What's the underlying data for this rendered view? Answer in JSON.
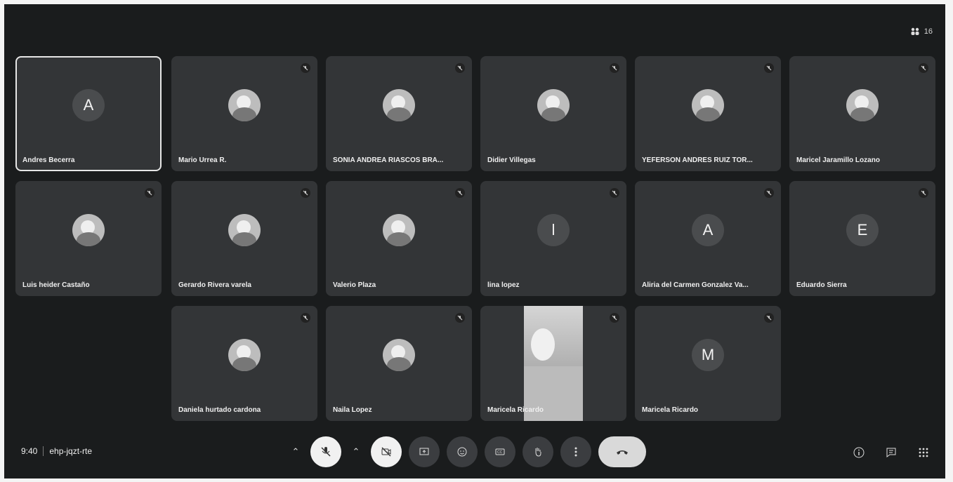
{
  "header": {
    "participant_count": "16"
  },
  "tiles": [
    {
      "name": "Andres Becerra",
      "initial": "A"
    },
    {
      "name": "Mario Urrea R."
    },
    {
      "name": "SONIA ANDREA RIASCOS BRA..."
    },
    {
      "name": "Didier Villegas"
    },
    {
      "name": "YEFERSON ANDRES RUIZ TOR..."
    },
    {
      "name": "Maricel Jaramillo Lozano"
    },
    {
      "name": "Luis heider Castaño"
    },
    {
      "name": "Gerardo Rivera varela"
    },
    {
      "name": "Valerio Plaza"
    },
    {
      "name": "lina lopez",
      "initial": "l"
    },
    {
      "name": "Aliria del Carmen Gonzalez Va...",
      "initial": "A"
    },
    {
      "name": "Eduardo Sierra",
      "initial": "E"
    },
    {
      "name": "Daniela hurtado cardona"
    },
    {
      "name": "Naila Lopez"
    },
    {
      "name": "Maricela Ricardo"
    },
    {
      "name": "Maricela Ricardo",
      "initial": "M"
    }
  ],
  "footer": {
    "time": "9:40",
    "meeting_code": "ehp-jqzt-rte"
  },
  "icons": {
    "participants": "people-icon",
    "mute": "mic-off-icon",
    "camera": "camera-off-icon",
    "present": "present-icon",
    "emoji": "emoji-icon",
    "captions": "captions-icon",
    "raise_hand": "hand-icon",
    "more": "more-icon",
    "end": "phone-end-icon",
    "info": "info-icon",
    "chat": "chat-icon",
    "activities": "apps-icon"
  },
  "colors": {
    "background": "#1a1c1d",
    "tile": "#333537"
  }
}
